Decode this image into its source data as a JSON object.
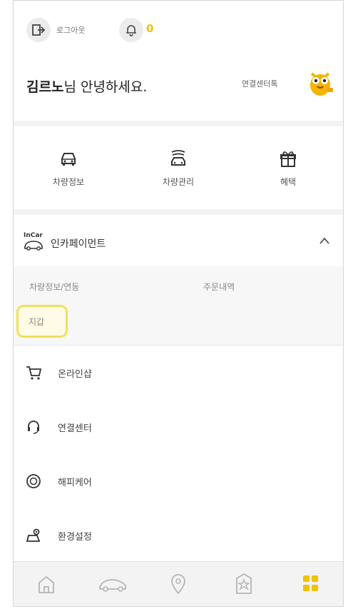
{
  "header": {
    "logout_label": "로그아웃",
    "bell_count": "0",
    "greeting_name": "김르노",
    "greeting_suffix": "님 안녕하세요.",
    "contact_label": "연결센터톡"
  },
  "quick_menu": [
    {
      "label": "차량정보",
      "icon": "car-front-icon"
    },
    {
      "label": "차량관리",
      "icon": "car-wash-icon"
    },
    {
      "label": "혜택",
      "icon": "gift-icon"
    }
  ],
  "incar": {
    "logo_text": "InCar",
    "title": "인카페이먼트",
    "sub_items": [
      "차량정보/연동",
      "주문내역"
    ],
    "wallet_label": "지갑"
  },
  "menu": [
    {
      "label": "온라인샵",
      "icon": "cart-icon"
    },
    {
      "label": "연결센터",
      "icon": "headset-icon"
    },
    {
      "label": "해피케어",
      "icon": "care-icon"
    },
    {
      "label": "환경설정",
      "icon": "settings-icon"
    }
  ],
  "bottom_nav": [
    "home-icon",
    "car-icon",
    "location-icon",
    "star-icon",
    "grid-menu-icon"
  ],
  "colors": {
    "accent": "#f2c100",
    "highlight_border": "#ede35a",
    "divider": "#f3f3f3"
  }
}
